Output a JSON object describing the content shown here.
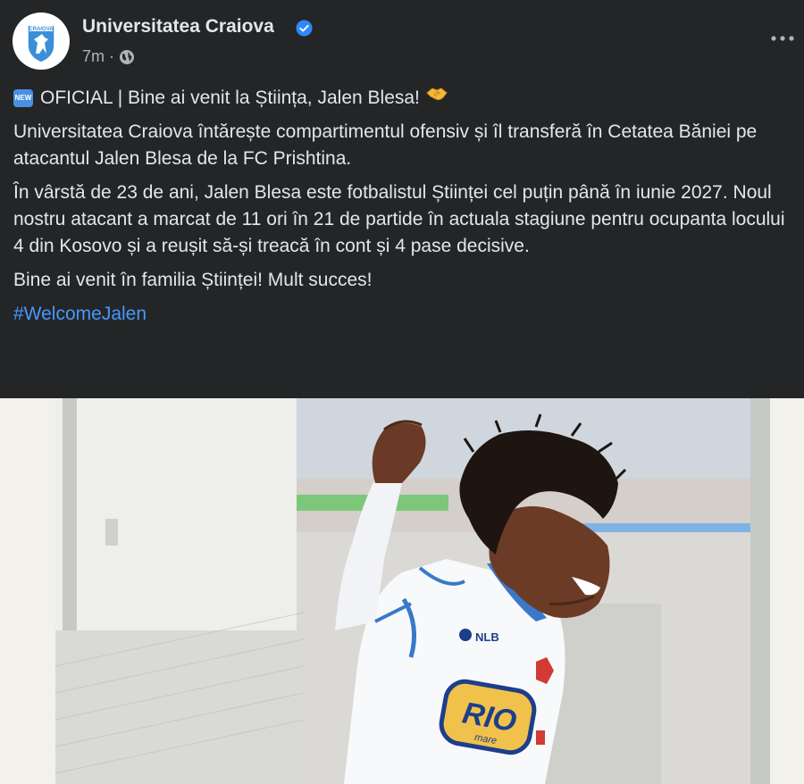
{
  "post": {
    "author": "Universitatea Craiova",
    "time": "7m",
    "time_separator": "·",
    "audience_icon": "globe-icon",
    "more_icon": "more-options-icon",
    "badge_label": "NEW",
    "headline": "OFICIAL | Bine ai venit la Știința, Jalen Blesa!",
    "paragraphs": [
      "Universitatea Craiova întărește compartimentul ofensiv și îl transferă în Cetatea Băniei pe atacantul Jalen Blesa de la FC Prishtina.",
      "În vârstă de 23 de ani, Jalen Blesa este fotbalistul Științei cel puțin până în iunie 2027. Noul nostru atacant a marcat de 11 ori în 21 de partide în actuala stagiune pentru ocupanta locului 4 din Kosovo și a reușit să-și treacă în cont și 4 pase decisive.",
      "Bine ai venit în familia Științei! Mult succes!"
    ],
    "hashtag": "#WelcomeJalen"
  },
  "logo": {
    "text": "CRAIOVA"
  },
  "photo": {
    "sponsor_text": "RIO",
    "sponsor_sub": "mare",
    "kit_brand": "NLB"
  },
  "colors": {
    "background": "#242526",
    "text": "#e4e6eb",
    "secondary": "#b0b3b8",
    "link": "#4599ff",
    "verified": "#2d88ff"
  }
}
